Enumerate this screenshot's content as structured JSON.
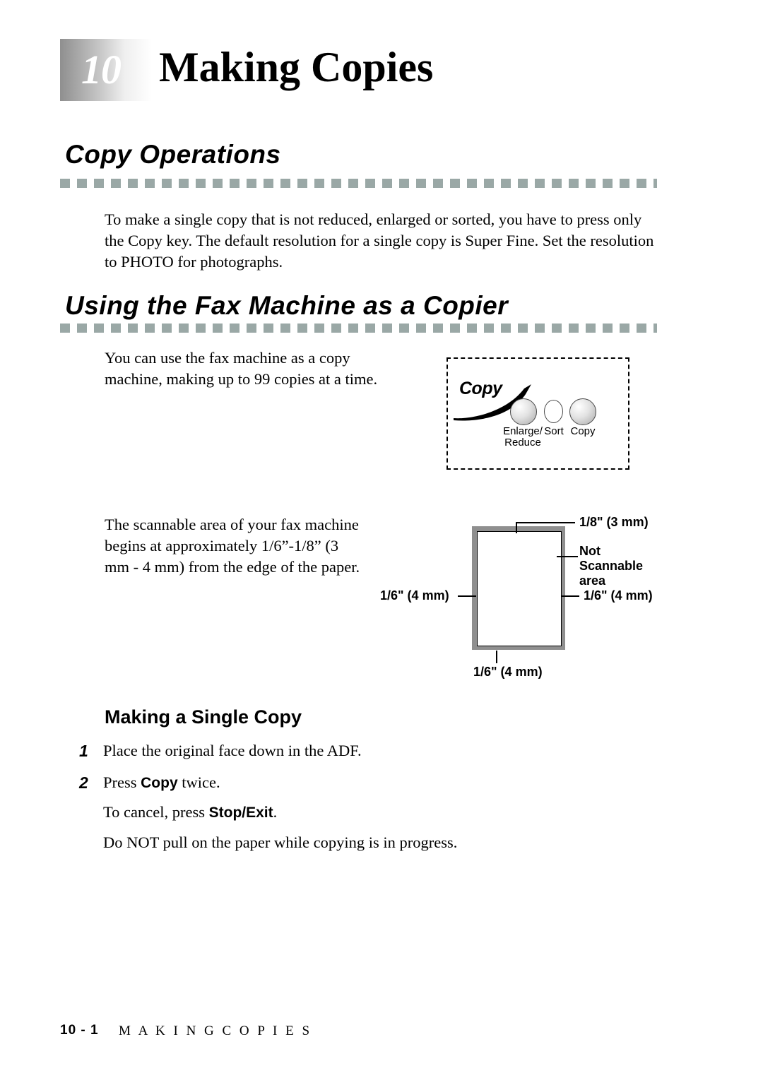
{
  "chapter": {
    "number": "10",
    "title": "Making Copies"
  },
  "sections": [
    {
      "heading": "Copy Operations",
      "paragraph": "To make a single copy that is not reduced, enlarged or sorted, you have to press only the Copy key. The default resolution for a single copy is Super Fine. Set the resolution to PHOTO for photographs."
    },
    {
      "heading": "Using the Fax Machine as a Copier",
      "paragraph": "You can use the fax machine as a copy machine, making up to 99 copies at a time.",
      "paragraph2": "The scannable area of your fax machine begins at approximately 1/6”-1/8” (3 mm - 4 mm) from the edge of the paper."
    }
  ],
  "panel_figure": {
    "brand_label": "Copy",
    "buttons": [
      {
        "label_line1": "Enlarge/",
        "label_line2": "Reduce"
      },
      {
        "label_line1": "Sort",
        "label_line2": ""
      },
      {
        "label_line1": "Copy",
        "label_line2": ""
      }
    ]
  },
  "scan_figure": {
    "top_dim": "1/8\" (3 mm)",
    "not_scannable_line1": "Not",
    "not_scannable_line2": "Scannable",
    "not_scannable_line3": "area",
    "left_dim": "1/6\" (4 mm)",
    "right_dim": "1/6\" (4 mm)",
    "bottom_dim": "1/6\" (4 mm)"
  },
  "subsection": {
    "heading": "Making a Single Copy",
    "steps": [
      {
        "num": "1",
        "text": "Place the original face down in the ADF."
      },
      {
        "num": "2",
        "text_pre": "Press ",
        "bold": "Copy",
        "text_post": " twice."
      }
    ],
    "cancel_pre": "To cancel, press ",
    "cancel_bold": "Stop/Exit",
    "cancel_post": ".",
    "note": "Do NOT pull on the paper while copying is in progress."
  },
  "footer": {
    "page": "10 - 1",
    "label": "M A K I N G   C O P I E S"
  }
}
